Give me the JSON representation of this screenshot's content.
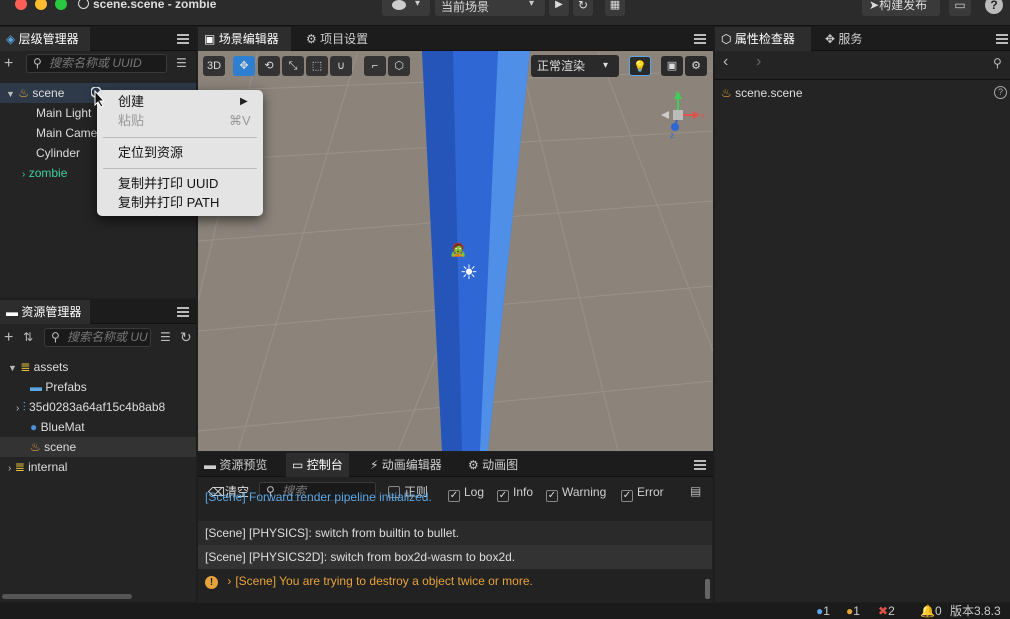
{
  "window": {
    "title": "scene.scene - zombie"
  },
  "toolbar": {
    "scene_select": "当前场景",
    "build_label": "构建发布"
  },
  "hierarchy": {
    "tab": "层级管理器",
    "search_placeholder": "搜索名称或 UUID",
    "items": [
      {
        "label": "scene"
      },
      {
        "label": "Main Light"
      },
      {
        "label": "Main Came"
      },
      {
        "label": "Cylinder"
      },
      {
        "label": "zombie"
      }
    ]
  },
  "context_menu": {
    "create": "创建",
    "paste": "粘贴",
    "paste_shortcut": "⌘V",
    "locate": "定位到资源",
    "copy_uuid": "复制并打印 UUID",
    "copy_path": "复制并打印 PATH"
  },
  "assets": {
    "tab": "资源管理器",
    "search_placeholder": "搜索名称或 UU",
    "items": [
      {
        "label": "assets"
      },
      {
        "label": "Prefabs"
      },
      {
        "label": "35d0283a64af15c4b8ab8"
      },
      {
        "label": "BlueMat"
      },
      {
        "label": "scene"
      },
      {
        "label": "internal"
      }
    ]
  },
  "scene_editor": {
    "tabs": [
      "场景编辑器",
      "项目设置"
    ],
    "btn_3d": "3D",
    "render_mode": "正常渲染",
    "gizmo": {
      "x": "x",
      "y": "y",
      "z": "z"
    }
  },
  "inspector": {
    "tabs": [
      "属性检查器",
      "服务"
    ],
    "node": "scene.scene"
  },
  "console": {
    "tabs": [
      "资源预览",
      "控制台",
      "动画编辑器",
      "动画图"
    ],
    "clear": "清空",
    "search_placeholder": "搜索",
    "filters": [
      {
        "label": "正则",
        "checked": false
      },
      {
        "label": "Log",
        "checked": true
      },
      {
        "label": "Info",
        "checked": true
      },
      {
        "label": "Warning",
        "checked": true
      },
      {
        "label": "Error",
        "checked": true
      }
    ],
    "logs": [
      "[Scene] Forward render pipeline initialized.",
      "[Scene] [PHYSICS]: switch from builtin to bullet.",
      "[Scene] [PHYSICS2D]: switch from box2d-wasm to box2d.",
      "[Scene] You are trying to destroy a object twice or more."
    ]
  },
  "statusbar": {
    "info": "1",
    "warn": "1",
    "error": "2",
    "notify": "0",
    "version": "版本3.8.3"
  },
  "colors": {
    "accent": "#2f7fd0",
    "selected_tree": "#3ecf9b",
    "warning": "#e8a33a",
    "error": "#e0514a"
  }
}
